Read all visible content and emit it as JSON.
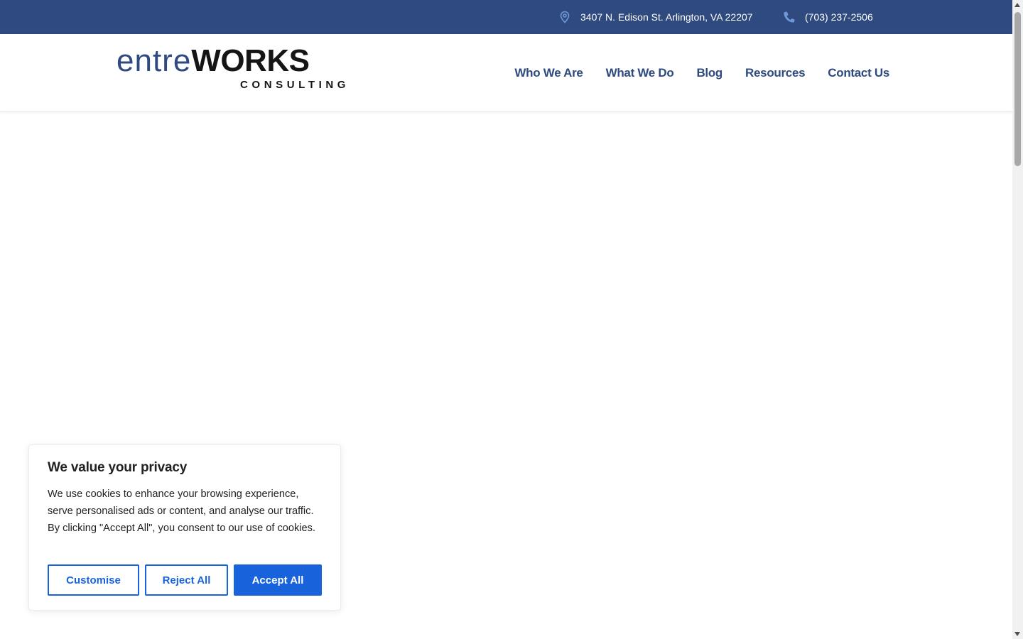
{
  "topbar": {
    "address": "3407 N. Edison St. Arlington, VA 22207",
    "address_icon": "location-pin-icon",
    "phone": "(703) 237-2506",
    "phone_icon": "phone-icon"
  },
  "logo": {
    "main_part1": "entre",
    "main_part2": "WORKS",
    "sub": "CONSULTING"
  },
  "nav": {
    "items": [
      {
        "label": "Who We Are"
      },
      {
        "label": "What We Do"
      },
      {
        "label": "Blog"
      },
      {
        "label": "Resources"
      },
      {
        "label": "Contact Us"
      }
    ]
  },
  "cookie_banner": {
    "title": "We value your privacy",
    "body": "We use cookies to enhance your browsing experience, serve personalised ads or content, and analyse our traffic. By clicking \"Accept All\", you consent to our use of cookies.",
    "customise_label": "Customise",
    "reject_label": "Reject All",
    "accept_label": "Accept All"
  },
  "colors": {
    "brand_navy": "#2e4a7e",
    "accent_blue": "#1863dc",
    "icon_light_blue": "#6f98d8"
  }
}
